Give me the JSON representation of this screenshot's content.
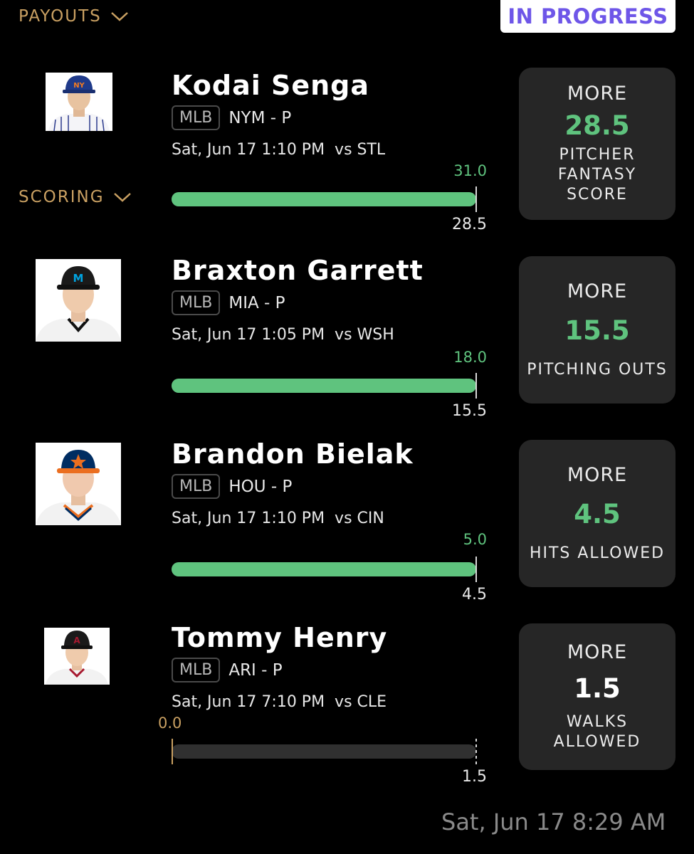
{
  "header": {
    "payouts_label": "PAYOUTS",
    "scoring_label": "SCORING",
    "status": "IN PROGRESS"
  },
  "picks": [
    {
      "player": "Kodai Senga",
      "league": "MLB",
      "team_pos": "NYM - P",
      "game": "Sat, Jun 17 1:10 PM  vs STL",
      "actual": "31.0",
      "line": "28.5",
      "direction": "MORE",
      "stat": "PITCHER FANTASY SCORE",
      "progress": 1.0
    },
    {
      "player": "Braxton Garrett",
      "league": "MLB",
      "team_pos": "MIA - P",
      "game": "Sat, Jun 17 1:05 PM  vs WSH",
      "actual": "18.0",
      "line": "15.5",
      "direction": "MORE",
      "stat": "PITCHING OUTS",
      "progress": 1.0
    },
    {
      "player": "Brandon Bielak",
      "league": "MLB",
      "team_pos": "HOU - P",
      "game": "Sat, Jun 17 1:10 PM  vs CIN",
      "actual": "5.0",
      "line": "4.5",
      "direction": "MORE",
      "stat": "HITS ALLOWED",
      "progress": 1.0
    },
    {
      "player": "Tommy Henry",
      "league": "MLB",
      "team_pos": "ARI - P",
      "game": "Sat, Jun 17 7:10 PM  vs CLE",
      "actual": "0.0",
      "line": "1.5",
      "direction": "MORE",
      "stat": "WALKS ALLOWED",
      "progress": 0.0
    }
  ],
  "footer": {
    "timestamp": "Sat, Jun 17 8:29 AM"
  },
  "colors": {
    "accent_gold": "#c9a062",
    "progress_green": "#5fc37e",
    "status_purple": "#6e56e8"
  }
}
